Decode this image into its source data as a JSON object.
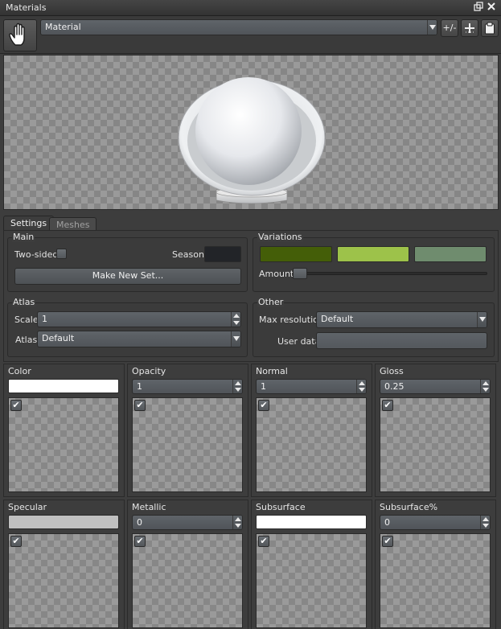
{
  "window": {
    "title": "Materials",
    "restore_icon": "restore-icon",
    "close_icon": "close-icon"
  },
  "toolbar": {
    "tool_icon": "hand-icon",
    "material_select": "Material",
    "plus_minus_label": "+/-",
    "add_icon": "plus-icon",
    "paste_icon": "clipboard-icon"
  },
  "tabs": [
    {
      "label": "Settings",
      "active": true
    },
    {
      "label": "Meshes",
      "active": false
    }
  ],
  "main": {
    "title": "Main",
    "two_sided_label": "Two-sided",
    "two_sided_checked": false,
    "season_label": "Season",
    "season_color": "#222428",
    "make_new_set_label": "Make New Set..."
  },
  "variations": {
    "title": "Variations",
    "colors": [
      "#445e08",
      "#9dc24a",
      "#6f8c6e"
    ],
    "amount_label": "Amount",
    "amount_value": 0
  },
  "atlas": {
    "title": "Atlas",
    "scale_label": "Scale",
    "scale_value": "1",
    "atlas_label": "Atlas",
    "atlas_value": "Default"
  },
  "other": {
    "title": "Other",
    "max_resolution_label": "Max resolution",
    "max_resolution_value": "Default",
    "user_data_label": "User data",
    "user_data_value": ""
  },
  "channels": [
    {
      "name": "Color",
      "kind": "color",
      "color": "#ffffff",
      "enabled": true
    },
    {
      "name": "Opacity",
      "kind": "number",
      "value": "1",
      "enabled": true
    },
    {
      "name": "Normal",
      "kind": "number",
      "value": "1",
      "enabled": true
    },
    {
      "name": "Gloss",
      "kind": "number",
      "value": "0.25",
      "enabled": true
    },
    {
      "name": "Specular",
      "kind": "color",
      "color": "#c0c0c0",
      "enabled": true
    },
    {
      "name": "Metallic",
      "kind": "number",
      "value": "0",
      "enabled": true
    },
    {
      "name": "Subsurface",
      "kind": "color",
      "color": "#ffffff",
      "enabled": true
    },
    {
      "name": "Subsurface%",
      "kind": "number",
      "value": "0",
      "enabled": true
    }
  ],
  "check_glyph": "✔"
}
